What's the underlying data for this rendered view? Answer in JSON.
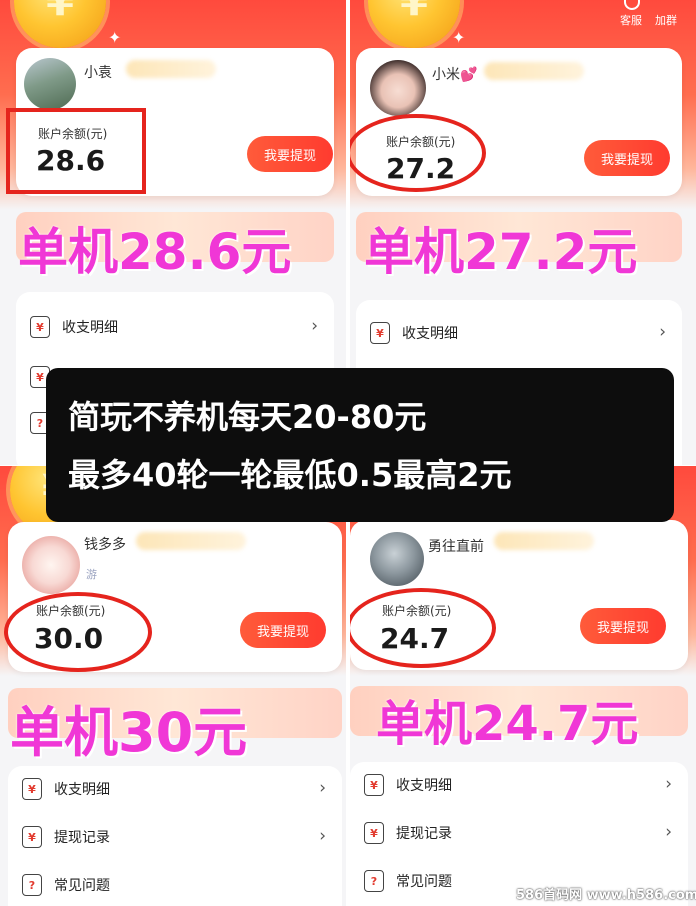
{
  "header": {
    "service_label": "客服",
    "group_label": "加群",
    "coin_symbol": "¥"
  },
  "panels": [
    {
      "username": "小袁",
      "balance_label": "账户余额(元)",
      "balance": "28.6",
      "withdraw_label": "我要提现",
      "headline": "单机28.6元",
      "menu": [
        "收支明细"
      ]
    },
    {
      "username": "小米💕",
      "balance_label": "账户余额(元)",
      "balance": "27.2",
      "withdraw_label": "我要提现",
      "headline": "单机27.2元",
      "menu": [
        "收支明细"
      ]
    },
    {
      "username": "钱多多",
      "subtext": "游",
      "balance_label": "账户余额(元)",
      "balance": "30.0",
      "withdraw_label": "我要提现",
      "headline": "单机30元",
      "menu": [
        "收支明细",
        "提现记录",
        "常见问题"
      ]
    },
    {
      "username": "勇往直前",
      "balance_label": "账户余额(元)",
      "balance": "24.7",
      "withdraw_label": "我要提现",
      "headline": "单机24.7元",
      "menu": [
        "收支明细",
        "提现记录",
        "常见问题"
      ]
    }
  ],
  "overlay": {
    "line1": "简玩不养机每天20-80元",
    "line2": "最多40轮一轮最低0.5最高2元"
  },
  "watermark": "586首码网 www.h586.com",
  "colors": {
    "accent_red": "#ff3b2f",
    "marker_red": "#e5241d",
    "headline_pink": "#f037d6"
  }
}
